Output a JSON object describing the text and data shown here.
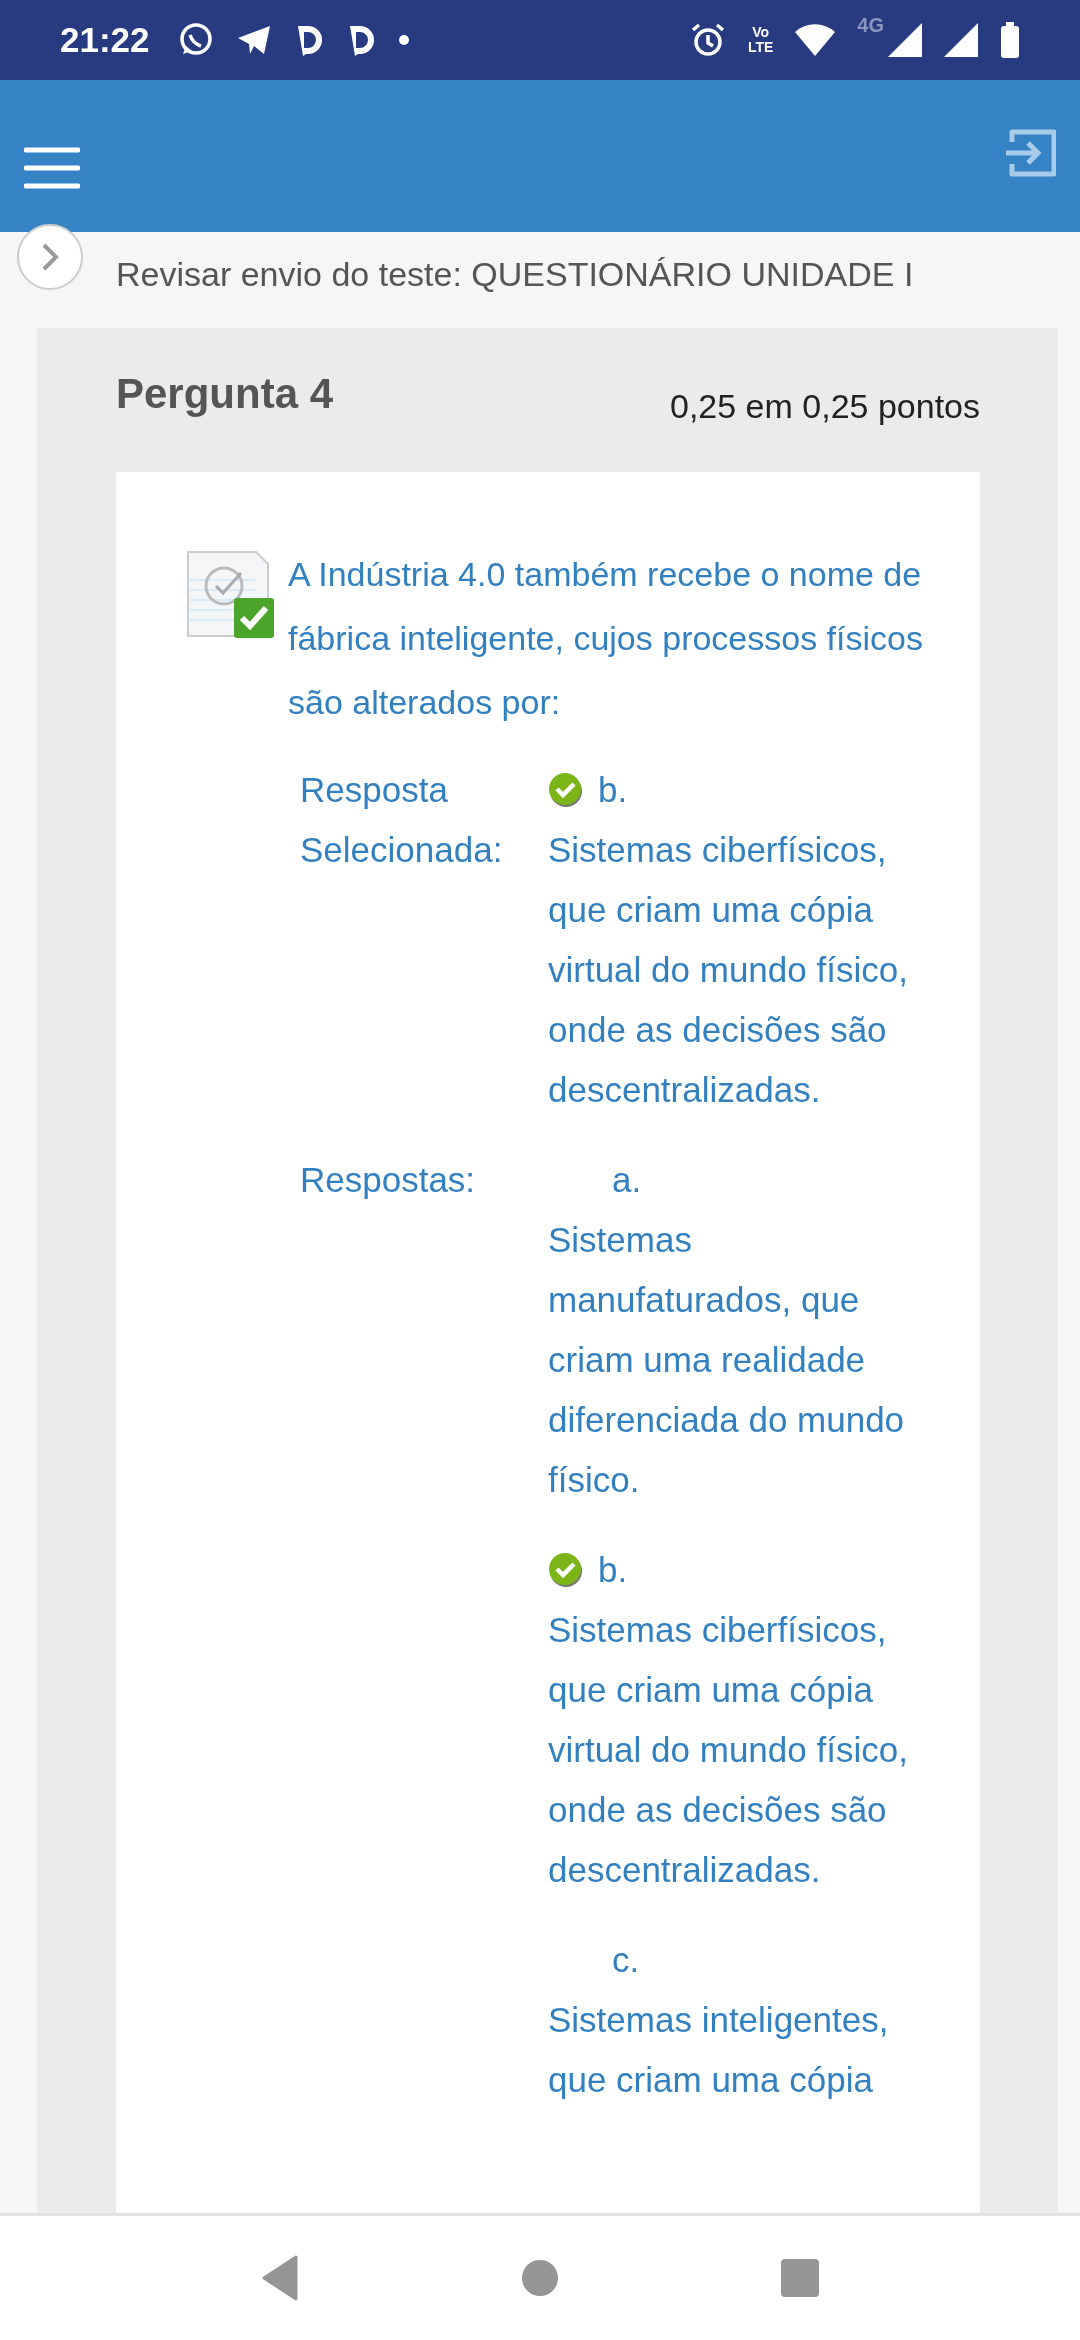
{
  "status_bar": {
    "time": "21:22",
    "volte_top": "Vo",
    "volte_bottom": "LTE",
    "network": "4G"
  },
  "breadcrumb": "Revisar envio do teste: QUESTIONÁRIO UNIDADE I",
  "question": {
    "title": "Pergunta 4",
    "score": "0,25 em 0,25 pontos",
    "text": "A Indústria 4.0 também recebe o nome de fábrica inteligente, cujos processos físicos são alterados por:",
    "selected_label": "Resposta Selecionada:",
    "selected_answer": {
      "letter": "b.",
      "correct": true,
      "text": "Sistemas ciberfísicos, que criam uma cópia virtual do mundo físico, onde as decisões são descentralizadas."
    },
    "answers_label": "Respostas:",
    "answers": [
      {
        "letter": "a.",
        "correct": false,
        "text": "Sistemas manufaturados, que criam uma realidade diferenciada do mundo físico."
      },
      {
        "letter": "b.",
        "correct": true,
        "text": "Sistemas ciberfísicos, que criam uma cópia virtual do mundo físico, onde as decisões são descentralizadas."
      },
      {
        "letter": "c.",
        "correct": false,
        "text": "Sistemas inteligentes, que criam uma cópia"
      }
    ]
  }
}
